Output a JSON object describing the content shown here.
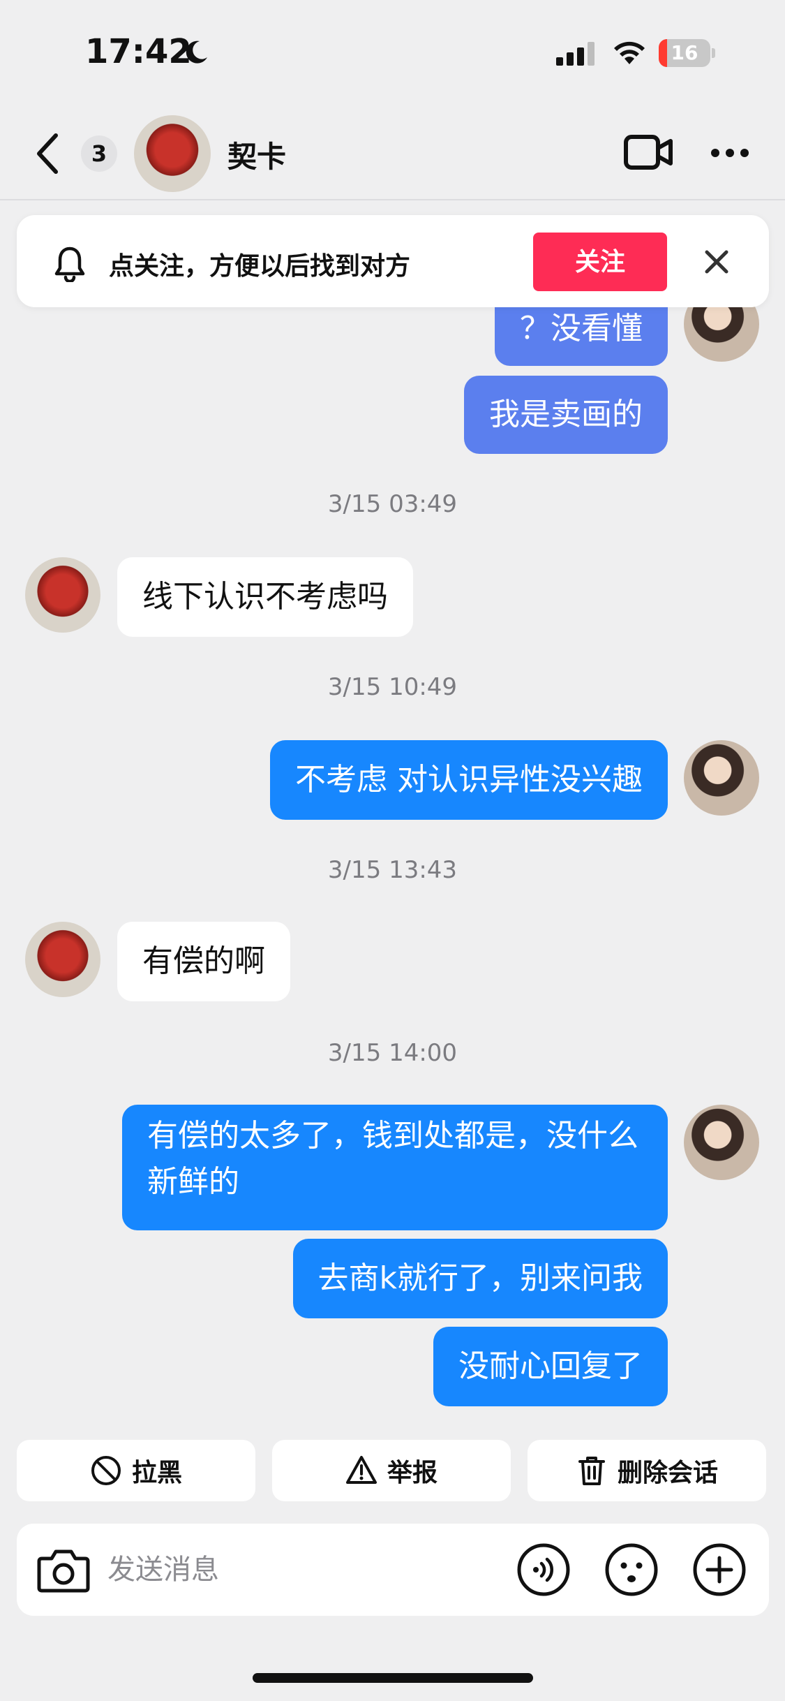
{
  "status_bar": {
    "time": "17:42",
    "battery_level": "16",
    "battery_fraction": 0.16,
    "moon_icon": "moon-icon",
    "signal_icon": "cellular-signal-icon",
    "wifi_icon": "wifi-icon"
  },
  "header": {
    "unread_count": "3",
    "peer_name": "契卡",
    "back_icon": "chevron-left-icon",
    "video_icon": "video-call-icon",
    "more_icon": "more-dots-icon"
  },
  "follow_banner": {
    "text": "点关注，方便以后找到对方",
    "button_label": "关注",
    "bell_icon": "bell-icon",
    "close_icon": "close-icon",
    "button_color": "#fe2c55"
  },
  "messages": [
    {
      "sender": "me",
      "text": "？没看懂"
    },
    {
      "sender": "me",
      "text": "我是卖画的"
    },
    {
      "type": "timestamp",
      "text": "3/15 03:49"
    },
    {
      "sender": "them",
      "text": "线下认识不考虑吗"
    },
    {
      "type": "timestamp",
      "text": "3/15 10:49"
    },
    {
      "sender": "me",
      "text": "不考虑 对认识异性没兴趣"
    },
    {
      "type": "timestamp",
      "text": "3/15 13:43"
    },
    {
      "sender": "them",
      "text": "有偿的啊"
    },
    {
      "type": "timestamp",
      "text": "3/15 14:00"
    },
    {
      "sender": "me",
      "text": "有偿的太多了，钱到处都是，没什么新鲜的"
    },
    {
      "sender": "me",
      "text": "去商k就行了，别来问我"
    },
    {
      "sender": "me",
      "text": "没耐心回复了"
    }
  ],
  "actions": [
    {
      "label": "拉黑",
      "icon": "block-icon"
    },
    {
      "label": "举报",
      "icon": "warning-icon"
    },
    {
      "label": "删除会话",
      "icon": "trash-icon"
    }
  ],
  "input_bar": {
    "placeholder": "发送消息",
    "camera_icon": "camera-icon",
    "voice_icon": "voice-icon",
    "emoji_icon": "emoji-icon",
    "plus_icon": "plus-icon"
  },
  "colors": {
    "my_bubble": "#1787fe",
    "their_bubble": "#ffffff",
    "background": "#efeff0"
  }
}
